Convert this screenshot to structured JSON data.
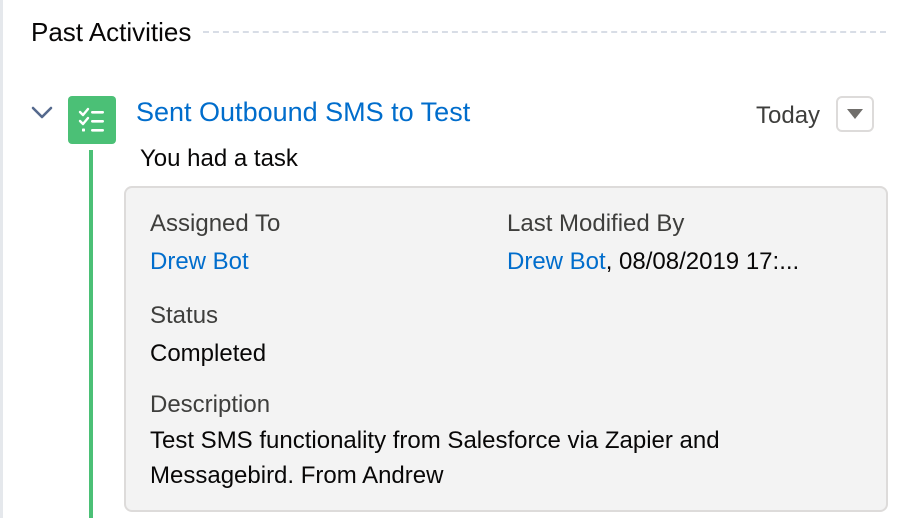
{
  "section": {
    "title": "Past Activities"
  },
  "activity": {
    "title": "Sent Outbound SMS to Test",
    "date": "Today",
    "subtitle": "You had a task",
    "icon": "task-checklist-icon",
    "accent_color": "#4bc076",
    "link_color": "#006dcc"
  },
  "details": {
    "assigned_to_label": "Assigned To",
    "assigned_to_value": "Drew Bot",
    "last_modified_label": "Last Modified By",
    "last_modified_user": "Drew Bot",
    "last_modified_date": ", 08/08/2019 17:...",
    "status_label": "Status",
    "status_value": "Completed",
    "description_label": "Description",
    "description_line1": "Test SMS functionality from Salesforce via Zapier and",
    "description_line2": "Messagebird. From Andrew"
  }
}
